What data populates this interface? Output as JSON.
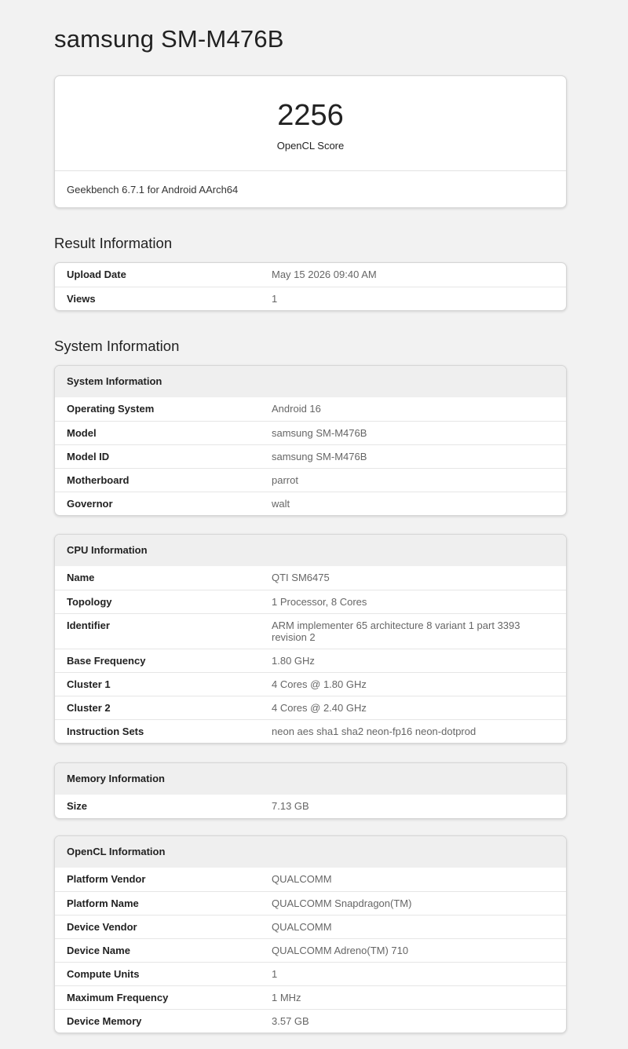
{
  "page": {
    "title": "samsung SM-M476B"
  },
  "score": {
    "value": "2256",
    "label": "OpenCL Score",
    "version": "Geekbench 6.7.1 for Android AArch64"
  },
  "result_section": {
    "heading": "Result Information",
    "rows": [
      {
        "label": "Upload Date",
        "value": "May 15 2026 09:40 AM"
      },
      {
        "label": "Views",
        "value": "1"
      }
    ]
  },
  "system_section": {
    "heading": "System Information",
    "system": {
      "title": "System Information",
      "rows": [
        {
          "label": "Operating System",
          "value": "Android 16"
        },
        {
          "label": "Model",
          "value": "samsung SM-M476B"
        },
        {
          "label": "Model ID",
          "value": "samsung SM-M476B"
        },
        {
          "label": "Motherboard",
          "value": "parrot"
        },
        {
          "label": "Governor",
          "value": "walt"
        }
      ]
    },
    "cpu": {
      "title": "CPU Information",
      "rows": [
        {
          "label": "Name",
          "value": "QTI SM6475"
        },
        {
          "label": "Topology",
          "value": "1 Processor, 8 Cores"
        },
        {
          "label": "Identifier",
          "value": "ARM implementer 65 architecture 8 variant 1 part 3393 revision 2"
        },
        {
          "label": "Base Frequency",
          "value": "1.80 GHz"
        },
        {
          "label": "Cluster 1",
          "value": "4 Cores @ 1.80 GHz"
        },
        {
          "label": "Cluster 2",
          "value": "4 Cores @ 2.40 GHz"
        },
        {
          "label": "Instruction Sets",
          "value": "neon aes sha1 sha2 neon-fp16 neon-dotprod"
        }
      ]
    },
    "memory": {
      "title": "Memory Information",
      "rows": [
        {
          "label": "Size",
          "value": "7.13 GB"
        }
      ]
    },
    "opencl": {
      "title": "OpenCL Information",
      "rows": [
        {
          "label": "Platform Vendor",
          "value": "QUALCOMM"
        },
        {
          "label": "Platform Name",
          "value": "QUALCOMM Snapdragon(TM)"
        },
        {
          "label": "Device Vendor",
          "value": "QUALCOMM"
        },
        {
          "label": "Device Name",
          "value": "QUALCOMM Adreno(TM) 710"
        },
        {
          "label": "Compute Units",
          "value": "1"
        },
        {
          "label": "Maximum Frequency",
          "value": "1 MHz"
        },
        {
          "label": "Device Memory",
          "value": "3.57 GB"
        }
      ]
    }
  }
}
